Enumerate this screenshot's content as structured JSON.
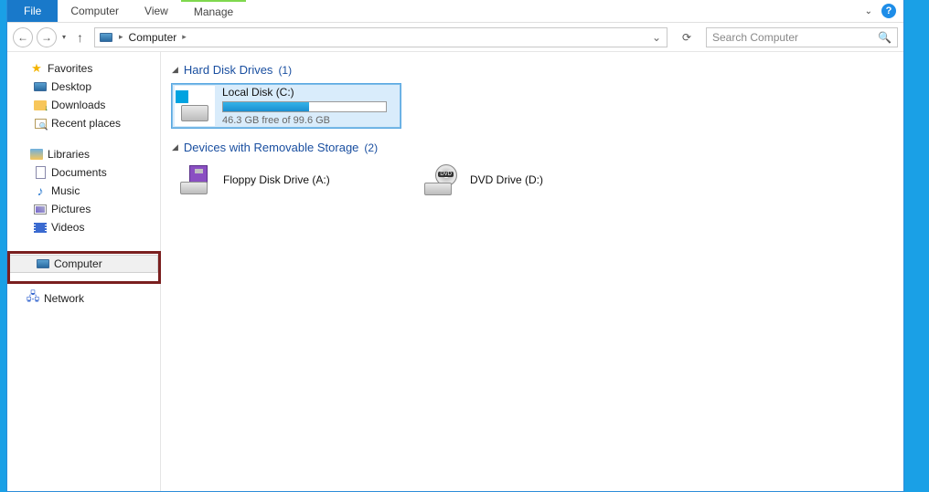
{
  "ribbon": {
    "file": "File",
    "tabs": [
      "Computer",
      "View",
      "Manage"
    ]
  },
  "address": {
    "location": "Computer"
  },
  "search": {
    "placeholder": "Search Computer"
  },
  "sidebar": {
    "favorites": {
      "label": "Favorites",
      "items": [
        "Desktop",
        "Downloads",
        "Recent places"
      ]
    },
    "libraries": {
      "label": "Libraries",
      "items": [
        "Documents",
        "Music",
        "Pictures",
        "Videos"
      ]
    },
    "computer": {
      "label": "Computer"
    },
    "network": {
      "label": "Network"
    }
  },
  "groups": {
    "hdd": {
      "title": "Hard Disk Drives",
      "count": "(1)",
      "drive": {
        "name": "Local Disk (C:)",
        "free_text": "46.3 GB free of 99.6 GB",
        "fill_percent": 53
      }
    },
    "removable": {
      "title": "Devices with Removable Storage",
      "count": "(2)",
      "devices": [
        {
          "name": "Floppy Disk Drive (A:)"
        },
        {
          "name": "DVD Drive (D:)"
        }
      ]
    }
  }
}
